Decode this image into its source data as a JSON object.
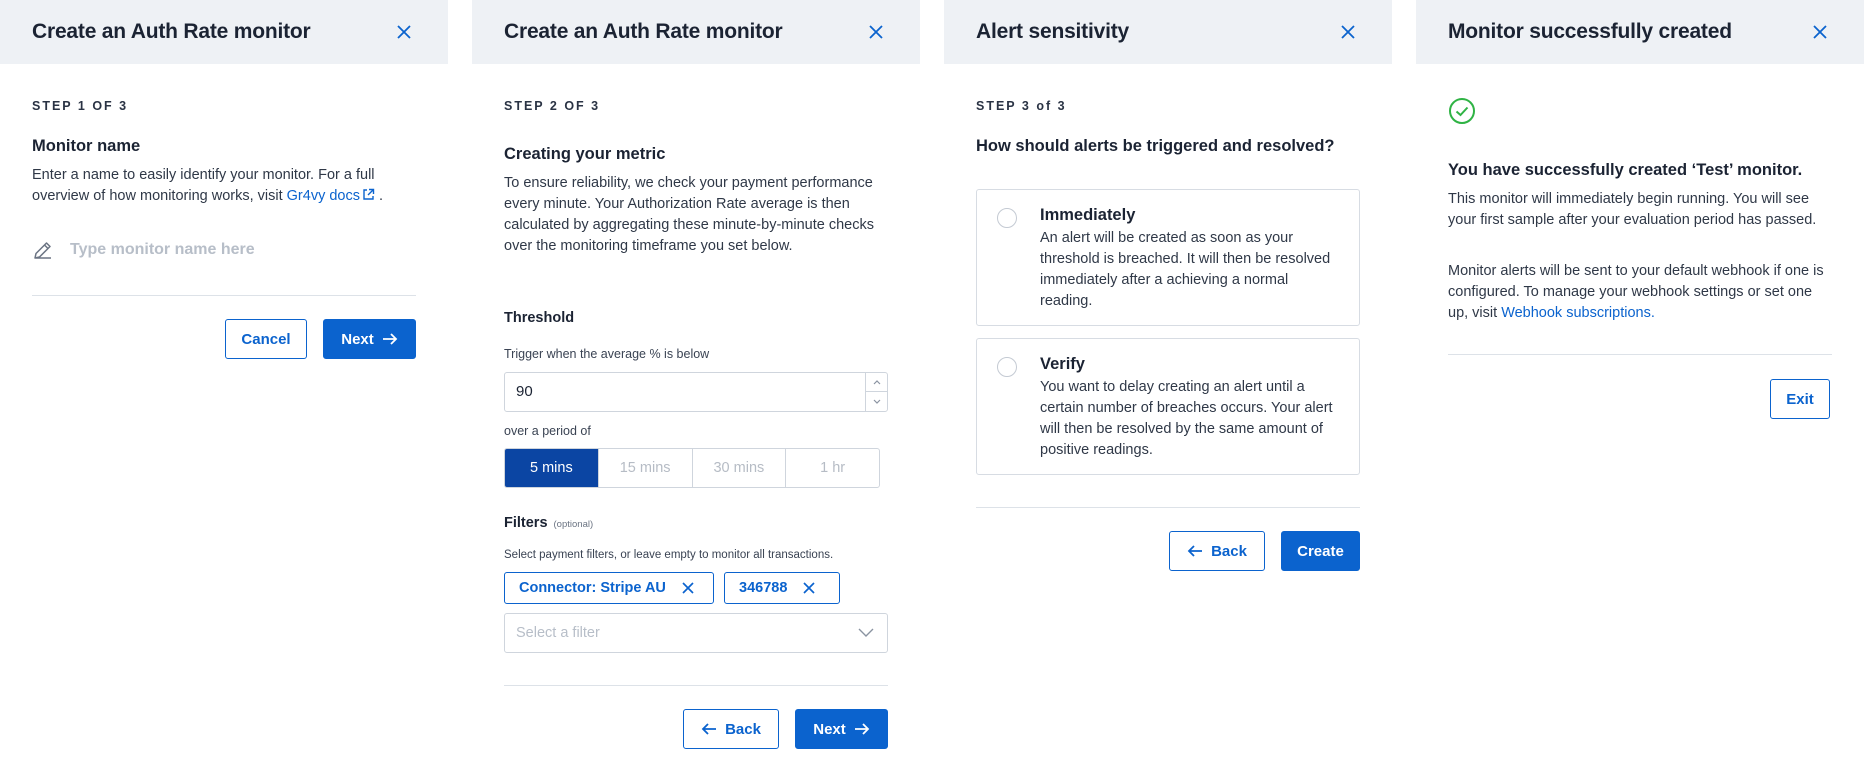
{
  "panel1": {
    "title": "Create an Auth Rate monitor",
    "step": "STEP 1 OF 3",
    "heading": "Monitor name",
    "desc_before": "Enter a name to easily identify your monitor. For a full overview of how monitoring works, visit ",
    "link": "Gr4vy docs",
    "desc_after": " .",
    "name_placeholder": "Type monitor name here",
    "cancel": "Cancel",
    "next": "Next"
  },
  "panel2": {
    "title": "Create an Auth Rate monitor",
    "step": "STEP 2 OF 3",
    "heading": "Creating your metric",
    "desc": "To ensure reliability, we check your payment performance every minute. Your Authorization Rate average is then calculated by aggregating these minute-by-minute checks over the monitoring timeframe you set below.",
    "threshold_heading": "Threshold",
    "trigger_label": "Trigger when the average % is below",
    "threshold_value": "90",
    "period_label": "over a period of",
    "periods": [
      "5 mins",
      "15 mins",
      "30 mins",
      "1 hr"
    ],
    "selected_period": "5 mins",
    "filters_heading": "Filters",
    "filters_optional": "(optional)",
    "filters_desc": "Select payment filters, or leave empty to monitor all transactions.",
    "chips": [
      "Connector: Stripe AU",
      "346788"
    ],
    "filter_placeholder": "Select a filter",
    "back": "Back",
    "next": "Next"
  },
  "panel3": {
    "title": "Alert sensitivity",
    "step": "STEP 3 of 3",
    "question": "How should alerts be triggered and resolved?",
    "options": [
      {
        "title": "Immediately",
        "desc": "An alert will be created as soon as your threshold is breached. It will then be resolved immediately after a achieving a normal reading."
      },
      {
        "title": "Verify",
        "desc": "You want to delay creating an alert until a certain number of breaches occurs. Your alert will then be resolved by the same amount of positive readings."
      }
    ],
    "back": "Back",
    "create": "Create"
  },
  "panel4": {
    "title": "Monitor successfully created",
    "heading": "You have successfully created ‘Test’ monitor.",
    "para1": "This monitor will immediately begin running. You will see your first sample after your evaluation period has passed.",
    "para2_before": "Monitor alerts will be sent to your default webhook if one is configured. To manage your webhook settings or set one up, visit ",
    "para2_link": "Webhook subscriptions.",
    "exit": "Exit"
  },
  "colors": {
    "accent": "#0b63ce",
    "selected": "#0b45a3",
    "success": "#2fb344",
    "header_bg": "#eef1f5"
  },
  "icons": [
    "close-icon",
    "pencil-icon",
    "external-link-icon",
    "arrow-right-icon",
    "arrow-left-icon",
    "chevron-down-icon",
    "check-circle-icon",
    "spinner-up-icon",
    "spinner-down-icon"
  ]
}
